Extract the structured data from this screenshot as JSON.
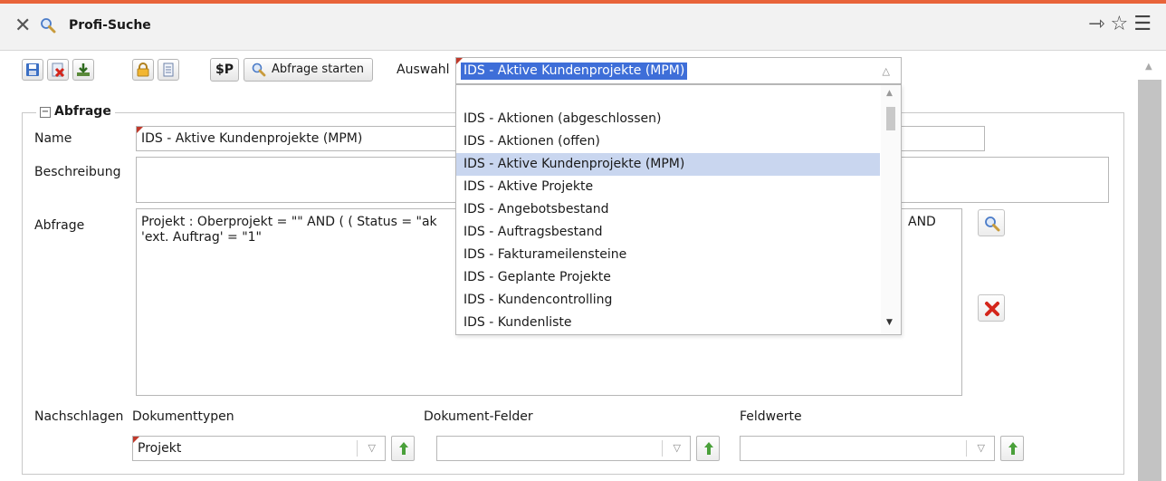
{
  "window": {
    "title": "Profi-Suche",
    "accent_color": "#e8643a",
    "icons": {
      "close": "close-icon",
      "search": "search-icon",
      "pin": "pin-icon",
      "star": "star-icon",
      "menu": "menu-icon"
    }
  },
  "toolbar": {
    "dollar_label": "$P",
    "start_label": "Abfrage starten",
    "auswahl_label": "Auswahl",
    "auswahl_value": "IDS - Aktive Kundenprojekte (MPM)"
  },
  "dropdown": {
    "selected_index": 2,
    "options": [
      "IDS - Aktionen (abgeschlossen)",
      "IDS - Aktionen (offen)",
      "IDS - Aktive Kundenprojekte (MPM)",
      "IDS - Aktive Projekte",
      "IDS - Angebotsbestand",
      "IDS - Auftragsbestand",
      "IDS - Fakturameilensteine",
      "IDS - Geplante Projekte",
      "IDS - Kundencontrolling",
      "IDS - Kundenliste"
    ]
  },
  "section": {
    "title": "Abfrage",
    "collapse_symbol": "−"
  },
  "form": {
    "name_label": "Name",
    "name_value": "IDS - Aktive Kundenprojekte (MPM)",
    "beschreibung_label": "Beschreibung",
    "beschreibung_value": "",
    "abfrage_label": "Abfrage",
    "abfrage_value": "Projekt : Oberprojekt = \"\" AND ( ( Status = \"ak\n'ext. Auftrag' = \"1\"",
    "abfrage_value_tail": "AND"
  },
  "lookup": {
    "nachschlagen_label": "Nachschlagen",
    "dokumenttypen_label": "Dokumenttypen",
    "dokumenttypen_value": "Projekt",
    "dokument_felder_label": "Dokument-Felder",
    "dokument_felder_value": "",
    "feldwerte_label": "Feldwerte",
    "feldwerte_value": ""
  }
}
